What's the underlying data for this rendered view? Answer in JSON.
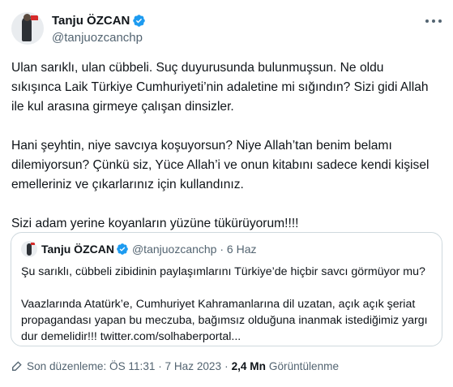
{
  "author": {
    "display_name": "Tanju ÖZCAN",
    "handle": "@tanjuozcanchp",
    "avatar_icon": "avatar-image",
    "verified_icon": "verified-badge-icon"
  },
  "tweet": {
    "paragraph_1": "Ulan sarıklı, ulan cübbeli. Suç duyurusunda bulunmuşsun. Ne oldu sıkışınca Laik Türkiye Cumhuriyeti’nin adaletine mi sığındın? Sizi gidi Allah ile kul arasına girmeye çalışan dinsizler.",
    "paragraph_2": "Hani şeyhtin, niye savcıya koşuyorsun? Niye Allah’tan benim belamı dilemiyorsun? Çünkü siz, Yüce Allah’i ve onun kitabını sadece kendi kişisel emelleriniz ve çıkarlarınız için kullandınız.",
    "paragraph_3": "Sizi adam yerine koyanların yüzüne tükürüyorum!!!!"
  },
  "quote": {
    "display_name": "Tanju ÖZCAN",
    "handle_date": "@tanjuozcanchp · 6 Haz",
    "paragraph_1": "Şu sarıklı, cübbeli zibidinin paylaşımlarını Türkiye’de hiçbir savcı görmüyor mu?",
    "paragraph_2": "Vaazlarında Atatürk’e, Cumhuriyet Kahramanlarına dil uzatan, açık açık şeriat propagandası yapan bu meczuba, bağımsız olduğuna inanmak istediğimiz yargı dur demelidir!!! twitter.com/solhaberportal..."
  },
  "footer": {
    "edited_label": "Son düzenleme: ÖS 11:31 · 7 Haz 2023",
    "separator": "·",
    "views_count": "2,4 Mn",
    "views_label": "Görüntülenme"
  },
  "colors": {
    "verified": "#1d9bf0",
    "secondary_text": "#536471",
    "border": "#cfd9de"
  }
}
